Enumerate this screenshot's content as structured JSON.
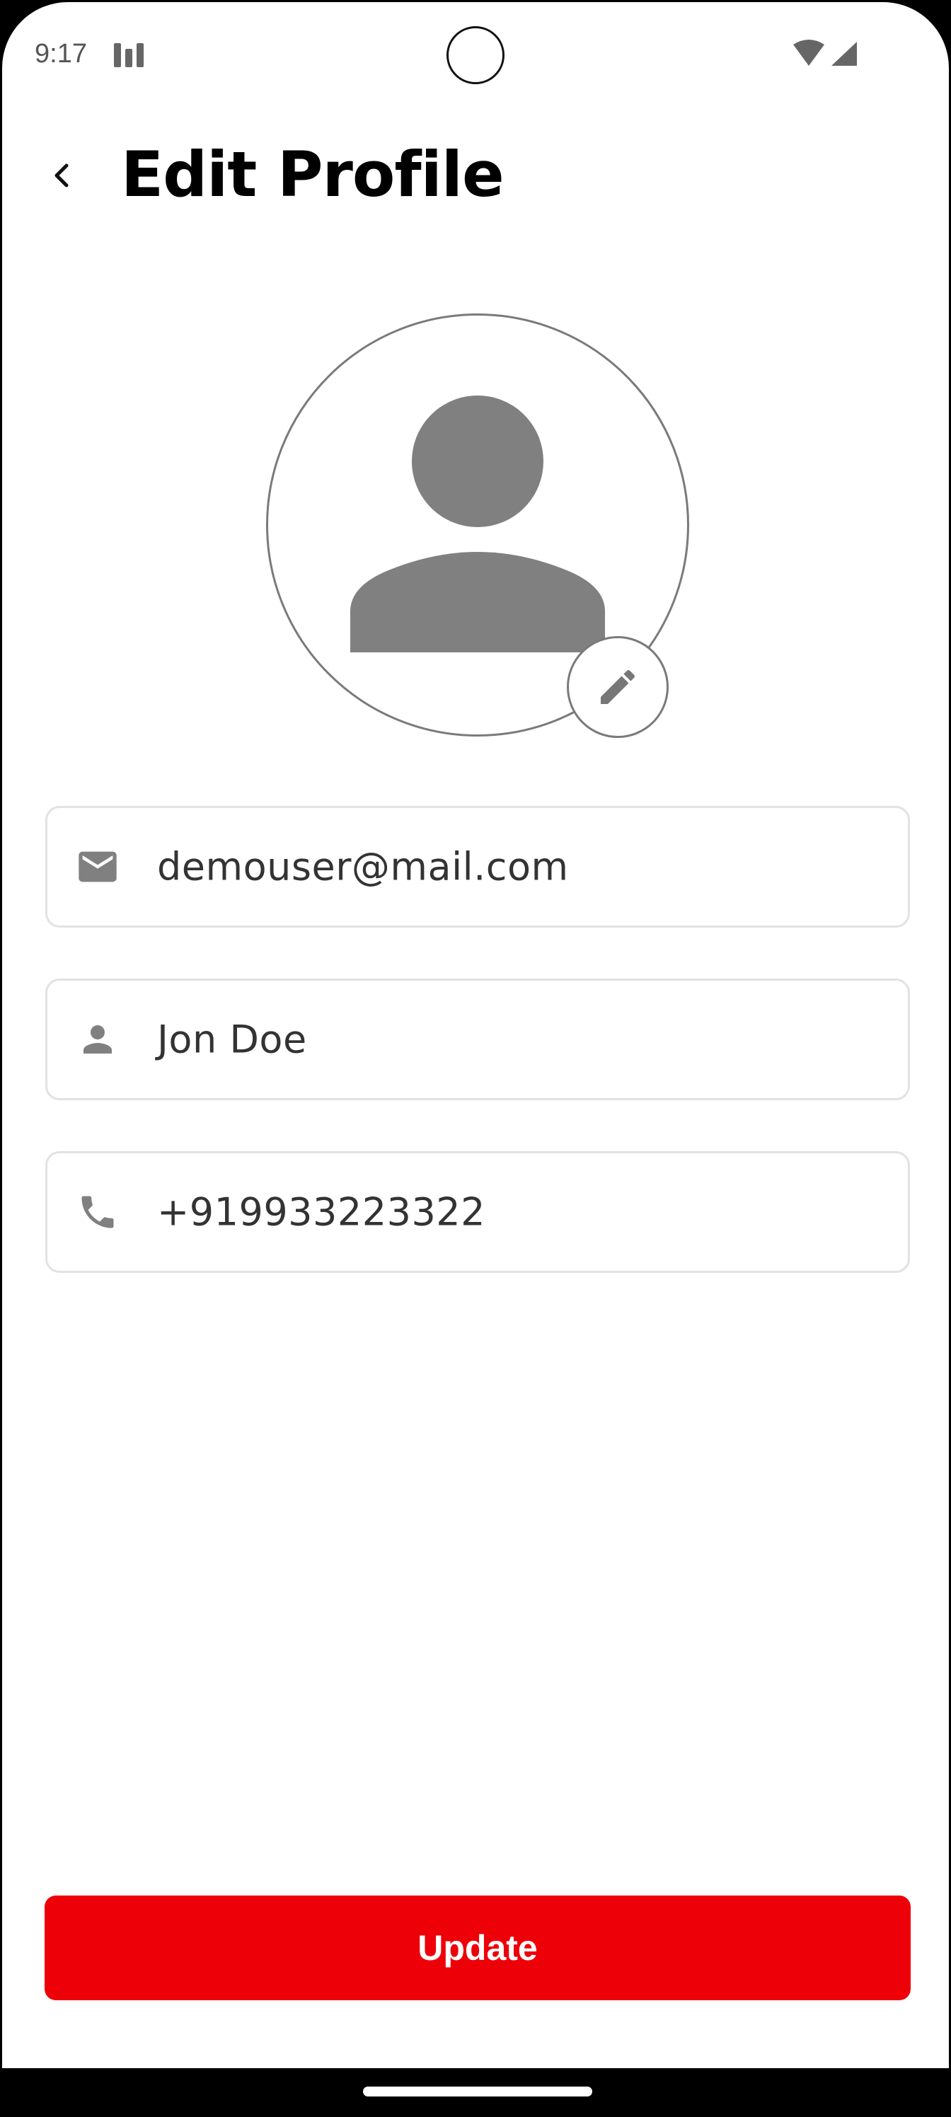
{
  "status_bar": {
    "time": "9:17",
    "icons": [
      "signal-bars-icon",
      "wifi-icon",
      "cellular-icon"
    ]
  },
  "header": {
    "back_icon": "chevron-left-icon",
    "title": "Edit Profile"
  },
  "avatar": {
    "icon": "person-avatar-icon",
    "edit_icon": "pencil-icon"
  },
  "fields": {
    "email": {
      "icon": "mail-icon",
      "value": "demouser@mail.com"
    },
    "name": {
      "icon": "person-icon",
      "value": "Jon Doe"
    },
    "phone": {
      "icon": "phone-icon",
      "value": "+919933223322"
    }
  },
  "update_button": {
    "label": "Update"
  },
  "colors": {
    "accent": "#ee0009",
    "icon_gray": "#808080",
    "border_gray": "#e2e2e2"
  }
}
